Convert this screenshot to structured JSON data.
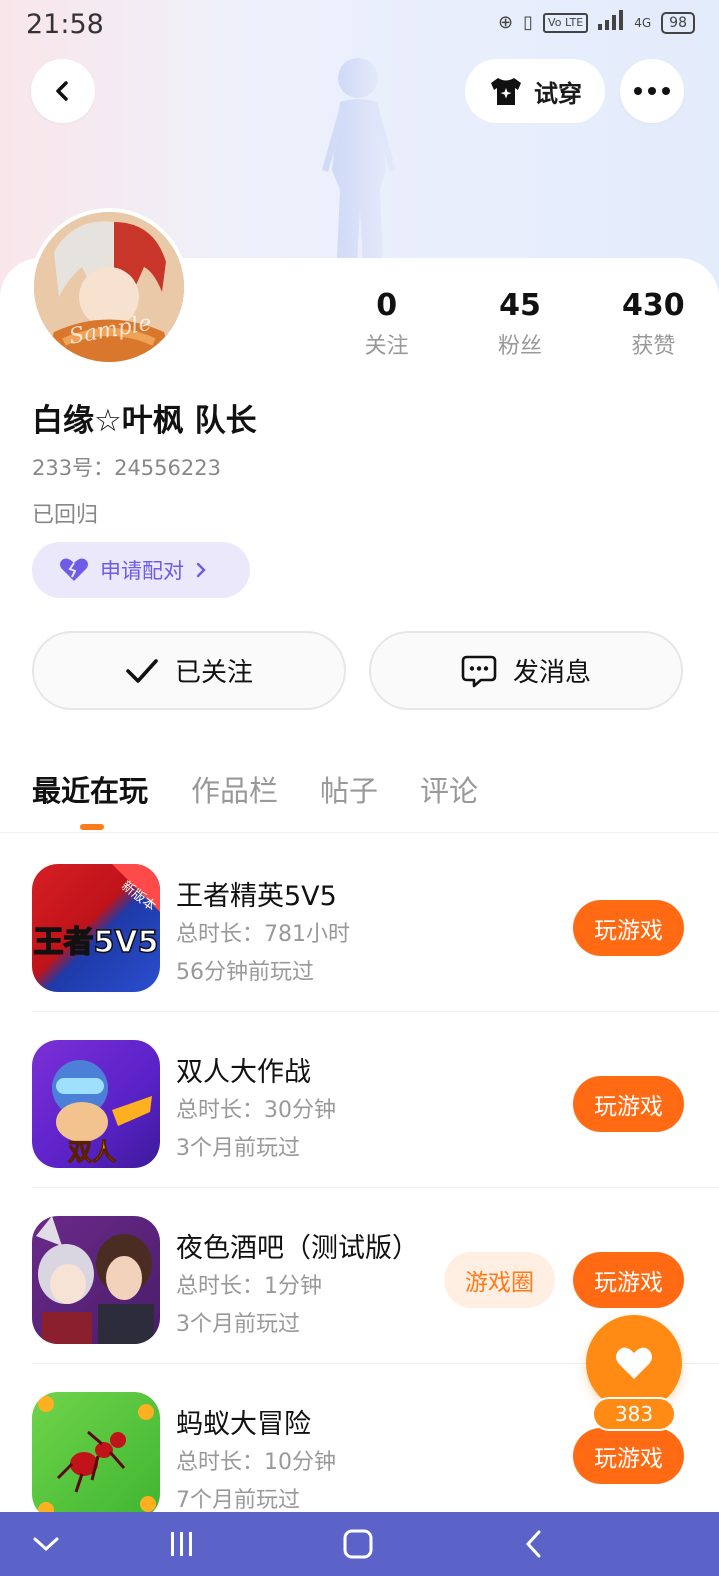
{
  "status_bar": {
    "time": "21:58",
    "network": "4G",
    "volte": "Vo LTE",
    "battery": "98"
  },
  "header": {
    "try_on_label": "试穿"
  },
  "profile": {
    "name": "白缘☆叶枫 队长",
    "uid": "233号：24556223",
    "status": "已回归",
    "pair_label": "申请配对",
    "avatar_watermark": "Sample",
    "stats": [
      {
        "value": "0",
        "label": "关注"
      },
      {
        "value": "45",
        "label": "粉丝"
      },
      {
        "value": "430",
        "label": "获赞"
      }
    ]
  },
  "actions": {
    "followed_label": "已关注",
    "message_label": "发消息"
  },
  "tabs": [
    {
      "label": "最近在玩",
      "active": true
    },
    {
      "label": "作品栏",
      "active": false
    },
    {
      "label": "帖子",
      "active": false
    },
    {
      "label": "评论",
      "active": false
    }
  ],
  "games": [
    {
      "title": "王者精英5V5",
      "duration": "总时长：781小时",
      "last_played": "56分钟前玩过",
      "play_label": "玩游戏",
      "icon_text": "王者5V5",
      "badge": "新版本"
    },
    {
      "title": "双人大作战",
      "duration": "总时长：30分钟",
      "last_played": "3个月前玩过",
      "play_label": "玩游戏",
      "icon_text": "双人"
    },
    {
      "title": "夜色酒吧（测试版）",
      "duration": "总时长：1分钟",
      "last_played": "3个月前玩过",
      "play_label": "玩游戏",
      "circle_label": "游戏圈"
    },
    {
      "title": "蚂蚁大冒险",
      "duration": "总时长：10分钟",
      "last_played": "7个月前玩过",
      "play_label": "玩游戏"
    }
  ],
  "like_fab": {
    "count": "383"
  },
  "colors": {
    "accent": "#ff6a13",
    "pair_purple": "#6c5ce7",
    "nav_bar": "#5b63c9"
  }
}
